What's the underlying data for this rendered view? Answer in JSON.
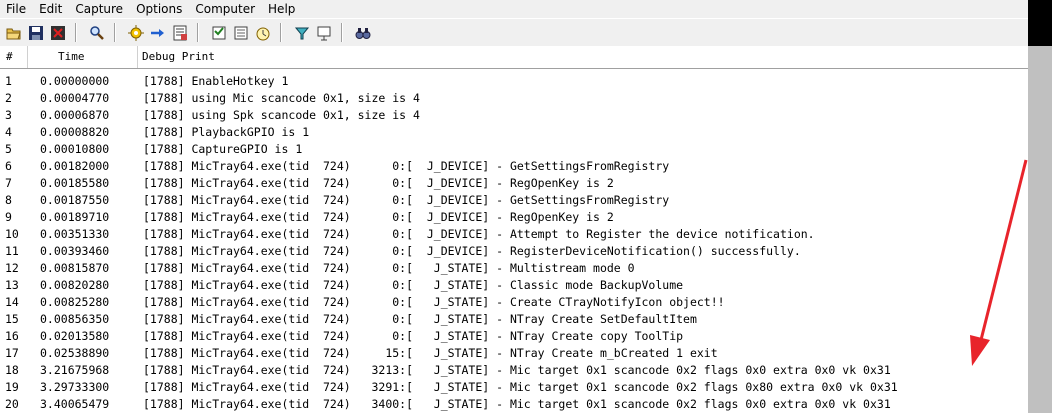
{
  "menu": [
    "File",
    "Edit",
    "Capture",
    "Options",
    "Computer",
    "Help"
  ],
  "toolbar_icons": [
    "open-icon",
    "save-icon",
    "exit-icon",
    "find-icon",
    "capture-icon",
    "autoscroll-icon",
    "clear-icon",
    "filter-icon",
    "highlight-icon",
    "timestamp-icon",
    "history-icon",
    "search-icon"
  ],
  "columns": {
    "num": "#",
    "time": "Time",
    "debug": "Debug Print"
  },
  "rows": [
    {
      "n": "1",
      "t": "0.00000000",
      "d": "[1788] EnableHotkey 1"
    },
    {
      "n": "2",
      "t": "0.00004770",
      "d": "[1788] using Mic scancode 0x1, size is 4"
    },
    {
      "n": "3",
      "t": "0.00006870",
      "d": "[1788] using Spk scancode 0x1, size is 4"
    },
    {
      "n": "4",
      "t": "0.00008820",
      "d": "[1788] PlaybackGPIO is 1"
    },
    {
      "n": "5",
      "t": "0.00010800",
      "d": "[1788] CaptureGPIO is 1"
    },
    {
      "n": "6",
      "t": "0.00182000",
      "d": "[1788] MicTray64.exe(tid  724)      0:[  J_DEVICE] - GetSettingsFromRegistry"
    },
    {
      "n": "7",
      "t": "0.00185580",
      "d": "[1788] MicTray64.exe(tid  724)      0:[  J_DEVICE] - RegOpenKey is 2"
    },
    {
      "n": "8",
      "t": "0.00187550",
      "d": "[1788] MicTray64.exe(tid  724)      0:[  J_DEVICE] - GetSettingsFromRegistry"
    },
    {
      "n": "9",
      "t": "0.00189710",
      "d": "[1788] MicTray64.exe(tid  724)      0:[  J_DEVICE] - RegOpenKey is 2"
    },
    {
      "n": "10",
      "t": "0.00351330",
      "d": "[1788] MicTray64.exe(tid  724)      0:[  J_DEVICE] - Attempt to Register the device notification."
    },
    {
      "n": "11",
      "t": "0.00393460",
      "d": "[1788] MicTray64.exe(tid  724)      0:[  J_DEVICE] - RegisterDeviceNotification() successfully."
    },
    {
      "n": "12",
      "t": "0.00815870",
      "d": "[1788] MicTray64.exe(tid  724)      0:[   J_STATE] - Multistream mode 0"
    },
    {
      "n": "13",
      "t": "0.00820280",
      "d": "[1788] MicTray64.exe(tid  724)      0:[   J_STATE] - Classic mode BackupVolume"
    },
    {
      "n": "14",
      "t": "0.00825280",
      "d": "[1788] MicTray64.exe(tid  724)      0:[   J_STATE] - Create CTrayNotifyIcon object!!"
    },
    {
      "n": "15",
      "t": "0.00856350",
      "d": "[1788] MicTray64.exe(tid  724)      0:[   J_STATE] - NTray Create SetDefaultItem"
    },
    {
      "n": "16",
      "t": "0.02013580",
      "d": "[1788] MicTray64.exe(tid  724)      0:[   J_STATE] - NTray Create copy ToolTip"
    },
    {
      "n": "17",
      "t": "0.02538890",
      "d": "[1788] MicTray64.exe(tid  724)     15:[   J_STATE] - NTray Create m_bCreated 1 exit"
    },
    {
      "n": "18",
      "t": "3.21675968",
      "d": "[1788] MicTray64.exe(tid  724)   3213:[   J_STATE] - Mic target 0x1 scancode 0x2 flags 0x0 extra 0x0 vk 0x31"
    },
    {
      "n": "19",
      "t": "3.29733300",
      "d": "[1788] MicTray64.exe(tid  724)   3291:[   J_STATE] - Mic target 0x1 scancode 0x2 flags 0x80 extra 0x0 vk 0x31"
    },
    {
      "n": "20",
      "t": "3.40065479",
      "d": "[1788] MicTray64.exe(tid  724)   3400:[   J_STATE] - Mic target 0x1 scancode 0x2 flags 0x0 extra 0x0 vk 0x31"
    }
  ],
  "colors": {
    "arrow": "#e8242b",
    "menubar": "#f0f0f0"
  }
}
